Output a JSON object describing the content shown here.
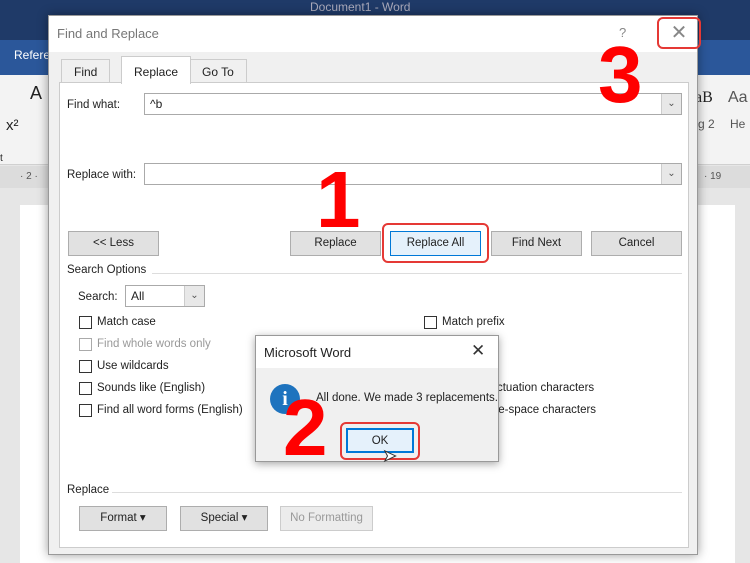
{
  "word": {
    "title": "Document1 - Word",
    "ribbon_tab": "Refere",
    "ruler_left": "· 2 ·",
    "ruler_right": "· 19",
    "style_preview_1": "aB",
    "style_preview_2": "Aa",
    "style_label_1": "g 2",
    "style_label_2": "He",
    "ribbon_font_letter": "A",
    "ribbon_superscript": "x²",
    "ribbon_side_label": "t"
  },
  "dialog": {
    "title": "Find and Replace",
    "help": "?",
    "tabs": [
      {
        "label": "Find"
      },
      {
        "label": "Replace"
      },
      {
        "label": "Go To"
      }
    ],
    "find_label": "Find what:",
    "find_value": "^b",
    "replace_label": "Replace with:",
    "replace_value": "",
    "buttons": {
      "less": "<< Less",
      "replace": "Replace",
      "replace_all": "Replace All",
      "find_next": "Find Next",
      "cancel": "Cancel"
    },
    "search_options_label": "Search Options",
    "search_label": "Search:",
    "search_value": "All",
    "options_left": [
      {
        "label": "Match case",
        "checked": false,
        "disabled": false
      },
      {
        "label": "Find whole words only",
        "checked": false,
        "disabled": true
      },
      {
        "label": "Use wildcards",
        "checked": false,
        "disabled": false
      },
      {
        "label": "Sounds like (English)",
        "checked": false,
        "disabled": false
      },
      {
        "label": "Find all word forms (English)",
        "checked": false,
        "disabled": false
      }
    ],
    "options_right": [
      {
        "label": "Match prefix"
      },
      {
        "label": "Ignore punctuation characters"
      },
      {
        "label": "Ignore white-space characters"
      }
    ],
    "replace_section_label": "Replace",
    "format_btn": "Format",
    "special_btn": "Special",
    "no_formatting_btn": "No Formatting"
  },
  "message_box": {
    "title": "Microsoft Word",
    "text": "All done. We made 3 replacements.",
    "ok": "OK",
    "icon": "info-icon"
  },
  "annotations": {
    "step1": "1",
    "step2": "2",
    "step3": "3",
    "color": "#ff0000"
  }
}
